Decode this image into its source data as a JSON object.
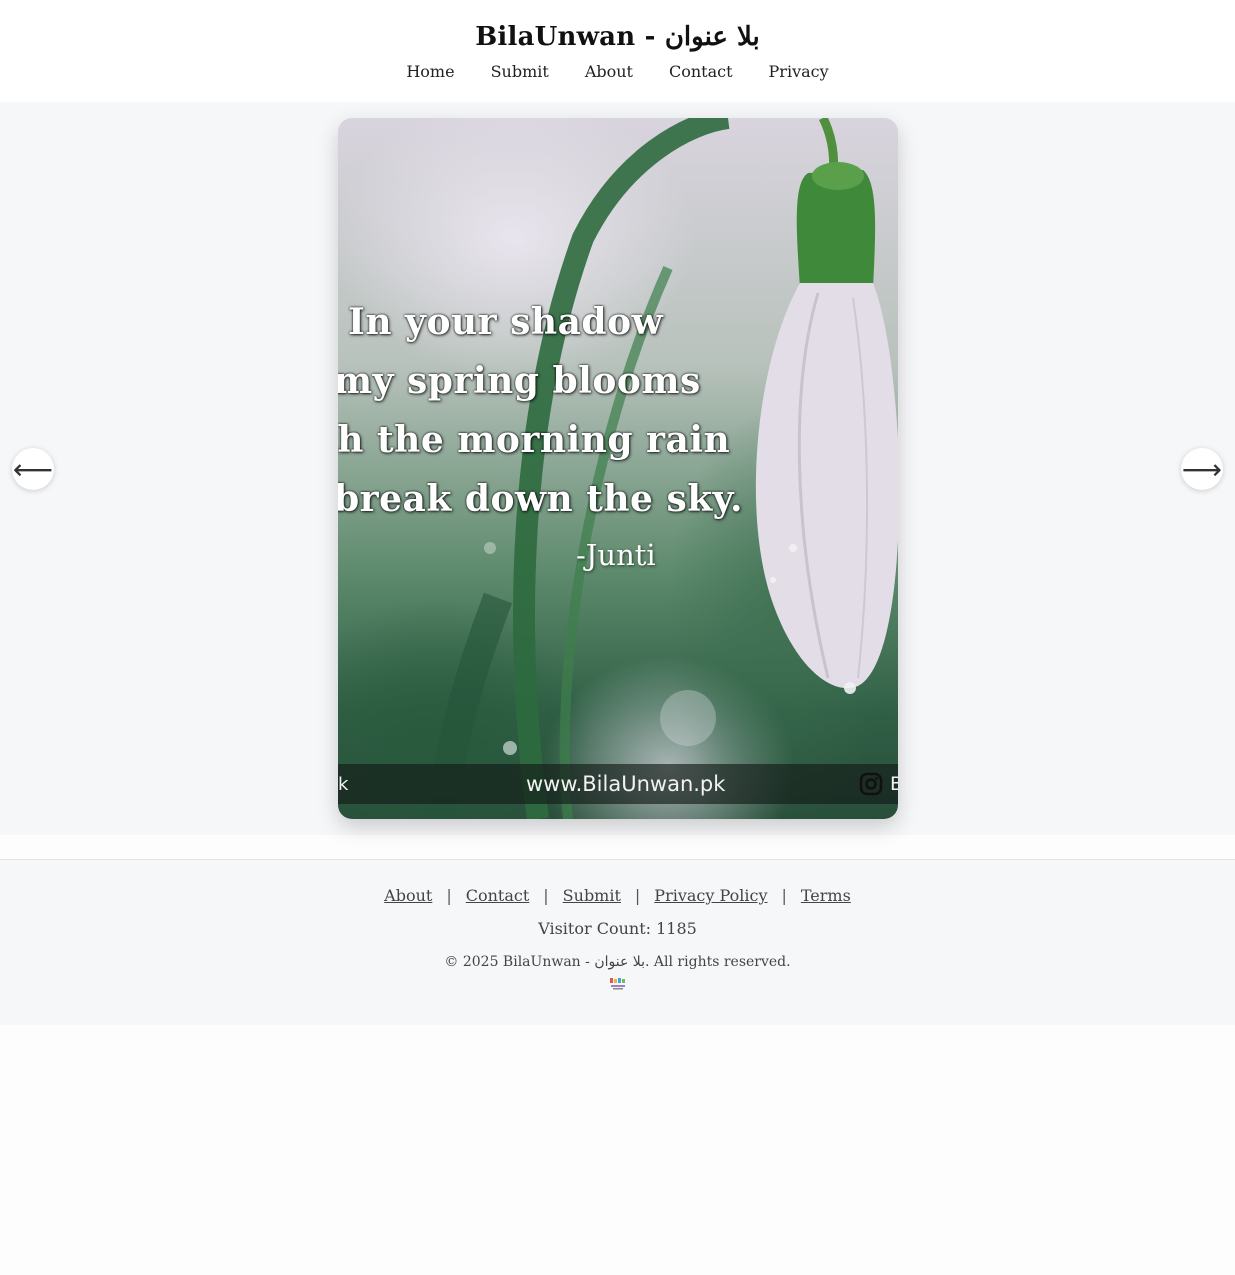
{
  "site": {
    "title": "BilaUnwan - بلا عنوان"
  },
  "nav": {
    "items": [
      {
        "label": "Home"
      },
      {
        "label": "Submit"
      },
      {
        "label": "About"
      },
      {
        "label": "Contact"
      },
      {
        "label": "Privacy"
      }
    ]
  },
  "slider": {
    "prev_arrow": "⟵",
    "next_arrow": "⟶",
    "slide": {
      "quote_lines": [
        "In your shadow",
        "my spring blooms",
        "ith the morning rain",
        "break down the sky."
      ],
      "author": "-Junti",
      "watermark_left": "k",
      "watermark_url": "www.BilaUnwan.pk",
      "watermark_right": "B",
      "watermark_icon": "instagram-icon"
    }
  },
  "footer": {
    "links": [
      {
        "label": "About"
      },
      {
        "label": "Contact"
      },
      {
        "label": "Submit"
      },
      {
        "label": "Privacy Policy"
      },
      {
        "label": "Terms"
      }
    ],
    "separator": "|",
    "visitor_count": "Visitor Count: 1185",
    "copyright": "© 2025 BilaUnwan - بلا عنوان. All rights reserved.",
    "logo_icon": "bilaunwan-logo-icon"
  },
  "colors": {
    "header_bg": "#ffffff",
    "page_bg": "#f6f7f9",
    "footer_bg": "#f6f7f9",
    "text": "#333333"
  }
}
